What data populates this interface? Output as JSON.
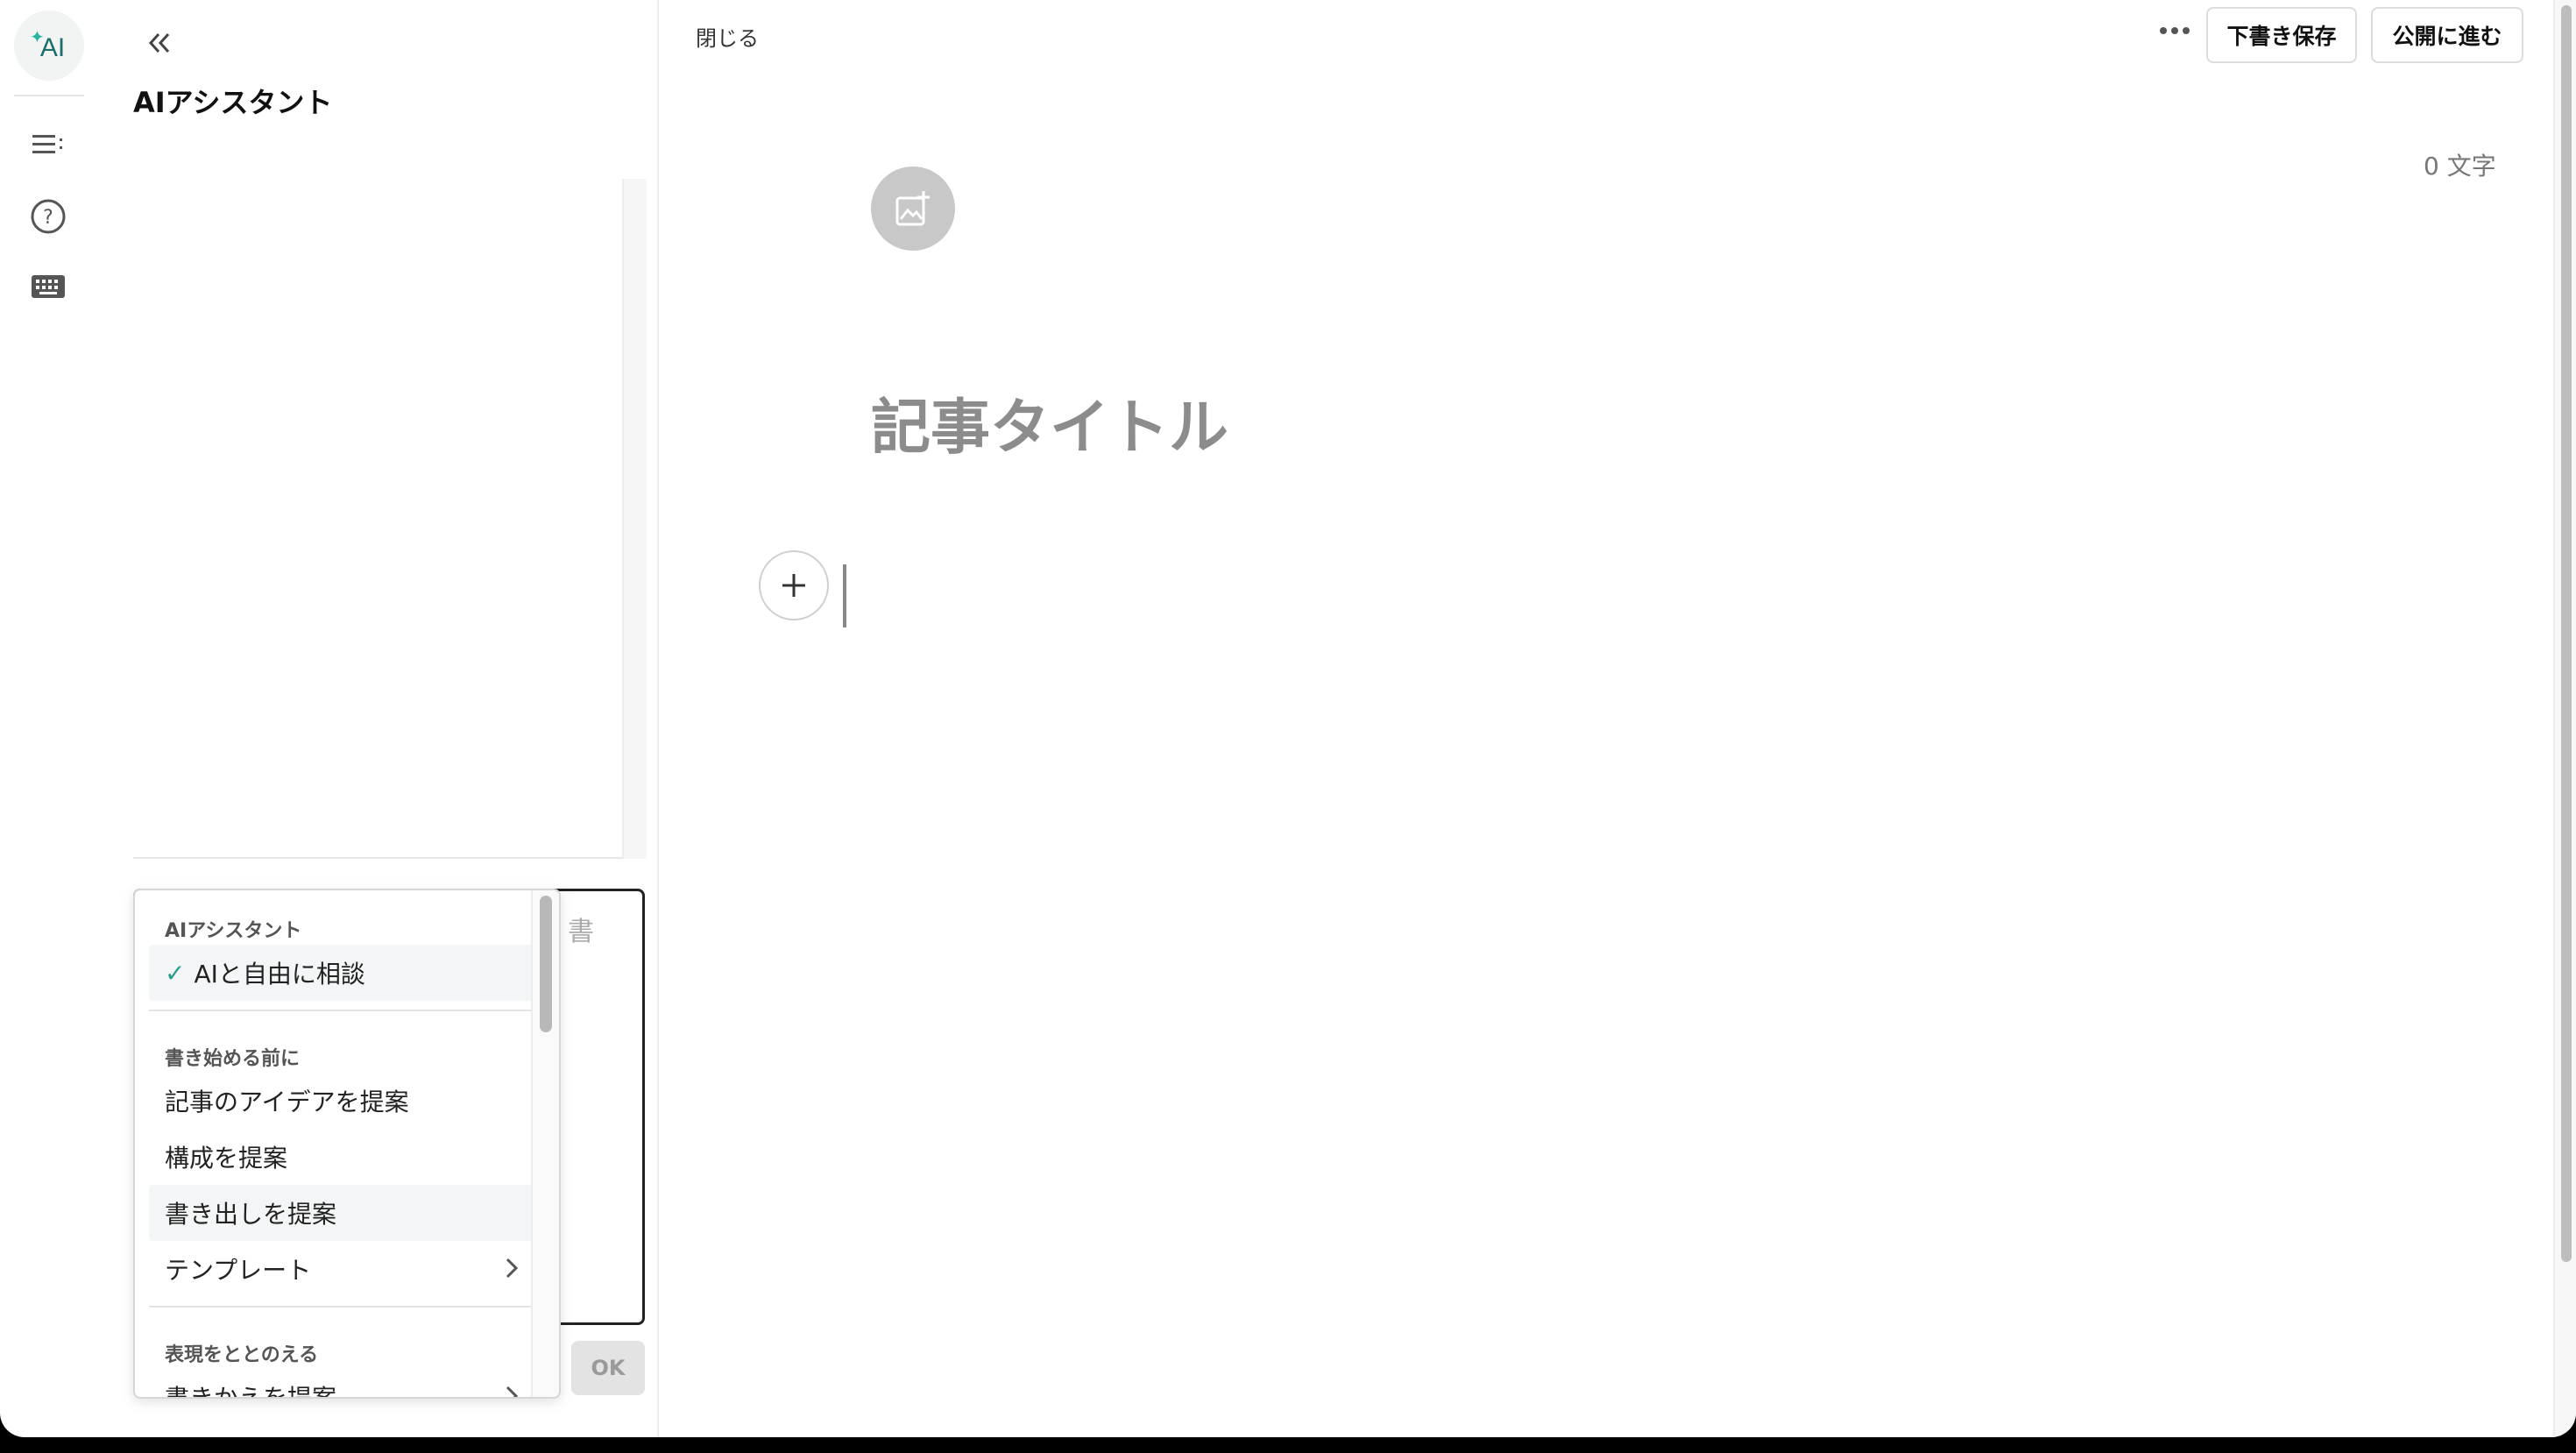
{
  "rail": {
    "ai_label": "AI",
    "icons": [
      "ai-sparkle-icon",
      "list-icon",
      "help-icon",
      "keyboard-icon"
    ]
  },
  "panel": {
    "title": "AIアシスタント",
    "input_placeholder": "書",
    "ok_label": "OK"
  },
  "dropdown": {
    "sections": [
      {
        "label": "AIアシスタント",
        "items": [
          {
            "label": "AIと自由に相談",
            "selected": true
          }
        ]
      },
      {
        "label": "書き始める前に",
        "items": [
          {
            "label": "記事のアイデアを提案"
          },
          {
            "label": "構成を提案"
          },
          {
            "label": "書き出しを提案",
            "hovered": true
          },
          {
            "label": "テンプレート",
            "has_submenu": true
          }
        ]
      },
      {
        "label": "表現をととのえる",
        "items": [
          {
            "label": "書きかえを提案",
            "has_submenu": true
          }
        ]
      }
    ]
  },
  "editor": {
    "close_label": "閉じる",
    "save_draft_label": "下書き保存",
    "publish_label": "公開に進む",
    "char_count": "0 文字",
    "title_placeholder": "記事タイトル"
  },
  "colors": {
    "accent": "#2a9d8f",
    "ai_text": "#1c6e6a"
  }
}
